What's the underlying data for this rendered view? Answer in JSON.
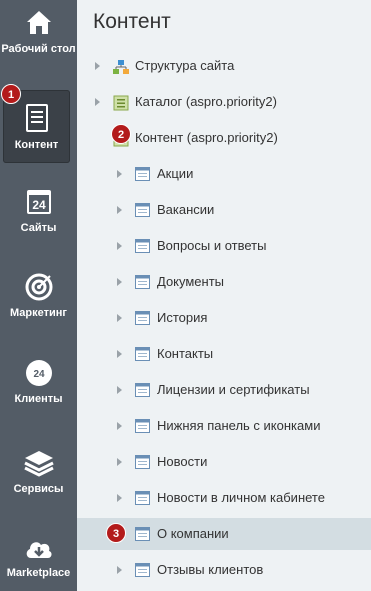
{
  "sidebar": {
    "items": [
      {
        "label": "Рабочий стол",
        "icon": "home-icon"
      },
      {
        "label": "Контент",
        "icon": "document-icon",
        "active": true
      },
      {
        "label": "Сайты",
        "icon": "calendar-24-icon"
      },
      {
        "label": "Маркетинг",
        "icon": "target-icon"
      },
      {
        "label": "Клиенты",
        "icon": "cloud-24-icon"
      },
      {
        "label": "Сервисы",
        "icon": "layers-icon"
      },
      {
        "label": "Marketplace",
        "icon": "cloud-download-icon"
      }
    ]
  },
  "badges": [
    "1",
    "2",
    "3"
  ],
  "main": {
    "title": "Контент",
    "tree": [
      {
        "label": "Структура сайта",
        "icon": "site-structure-icon"
      },
      {
        "label": "Каталог (aspro.priority2)",
        "icon": "folder-list-icon"
      },
      {
        "label": "Контент (aspro.priority2)",
        "icon": "folder-list-icon"
      },
      {
        "label": "Акции",
        "icon": "window-icon"
      },
      {
        "label": "Вакансии",
        "icon": "window-icon"
      },
      {
        "label": "Вопросы и ответы",
        "icon": "window-icon"
      },
      {
        "label": "Документы",
        "icon": "window-icon"
      },
      {
        "label": "История",
        "icon": "window-icon"
      },
      {
        "label": "Контакты",
        "icon": "window-icon"
      },
      {
        "label": "Лицензии и сертификаты",
        "icon": "window-icon"
      },
      {
        "label": "Нижняя панель с иконками",
        "icon": "window-icon"
      },
      {
        "label": "Новости",
        "icon": "window-icon"
      },
      {
        "label": "Новости в личном кабинете",
        "icon": "window-icon"
      },
      {
        "label": "О компании",
        "icon": "window-icon",
        "selected": true
      },
      {
        "label": "Отзывы клиентов",
        "icon": "window-icon"
      }
    ]
  },
  "colors": {
    "sidebar_bg": "#535c66",
    "main_bg": "#eef2f4",
    "selected_row": "#d3dde2",
    "badge": "#b31b1b"
  }
}
